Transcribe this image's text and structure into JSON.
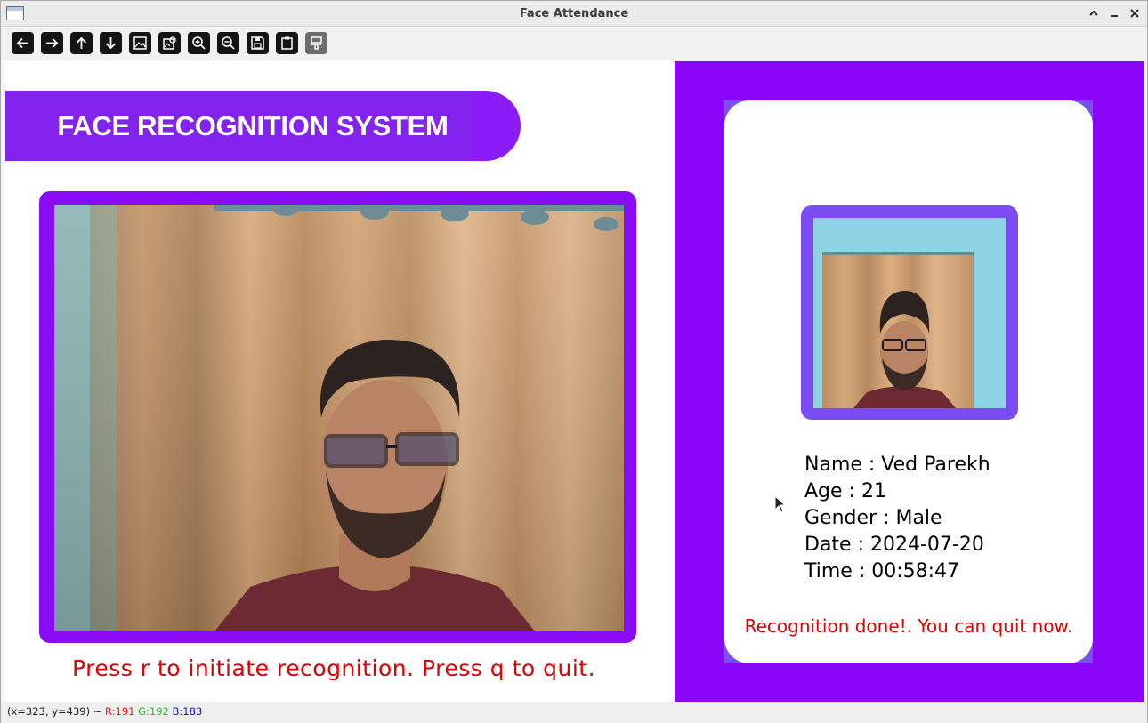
{
  "window": {
    "title": "Face Attendance"
  },
  "toolbar": {
    "buttons": [
      "pan-left",
      "pan-right",
      "pan-up",
      "pan-down",
      "zoom-image",
      "zoom-fit",
      "zoom-in",
      "zoom-out",
      "save",
      "copy-clipboard",
      "properties"
    ]
  },
  "header": {
    "title": "FACE RECOGNITION SYSTEM"
  },
  "left": {
    "hint": "Press r to initiate recognition. Press q to quit."
  },
  "profile": {
    "name_line": "Name : Ved Parekh",
    "age_line": "Age : 21",
    "gender_line": "Gender : Male",
    "date_line": "Date : 2024-07-20",
    "time_line": "Time : 00:58:47"
  },
  "status_message": "Recognition done!. You can quit now.",
  "statusbar": {
    "coords": "(x=323, y=439) ~",
    "r": "R:191",
    "g": "G:192",
    "b": "B:183"
  },
  "colors": {
    "accent_purple": "#8a0bf5",
    "frame_purple": "#7a4cf2",
    "message_red": "#e00000"
  }
}
